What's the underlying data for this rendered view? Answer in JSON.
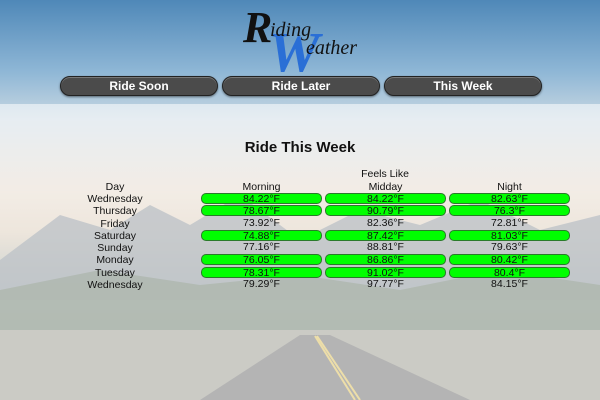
{
  "app": {
    "logo_text": "Riding Weather"
  },
  "nav": [
    {
      "label": "Ride Soon"
    },
    {
      "label": "Ride Later"
    },
    {
      "label": "This Week"
    }
  ],
  "page": {
    "title": "Ride This Week",
    "group_header": "Feels Like"
  },
  "table": {
    "columns": [
      "Day",
      "Morning",
      "Midday",
      "Night"
    ],
    "highlight_color": "#00ff00",
    "rows": [
      {
        "day": "Wednesday",
        "morning": "84.22°F",
        "midday": "84.22°F",
        "night": "82.63°F",
        "morning_good": true,
        "midday_good": true,
        "night_good": true
      },
      {
        "day": "Thursday",
        "morning": "78.67°F",
        "midday": "90.79°F",
        "night": "76.3°F",
        "morning_good": true,
        "midday_good": true,
        "night_good": true
      },
      {
        "day": "Friday",
        "morning": "73.92°F",
        "midday": "82.36°F",
        "night": "72.81°F",
        "morning_good": false,
        "midday_good": false,
        "night_good": false
      },
      {
        "day": "Saturday",
        "morning": "74.88°F",
        "midday": "87.42°F",
        "night": "81.03°F",
        "morning_good": true,
        "midday_good": true,
        "night_good": true
      },
      {
        "day": "Sunday",
        "morning": "77.16°F",
        "midday": "88.81°F",
        "night": "79.63°F",
        "morning_good": false,
        "midday_good": false,
        "night_good": false
      },
      {
        "day": "Monday",
        "morning": "76.05°F",
        "midday": "86.86°F",
        "night": "80.42°F",
        "morning_good": true,
        "midday_good": true,
        "night_good": true
      },
      {
        "day": "Tuesday",
        "morning": "78.31°F",
        "midday": "91.02°F",
        "night": "80.4°F",
        "morning_good": true,
        "midday_good": true,
        "night_good": true
      },
      {
        "day": "Wednesday",
        "morning": "79.29°F",
        "midday": "97.77°F",
        "night": "84.15°F",
        "morning_good": false,
        "midday_good": false,
        "night_good": false
      }
    ]
  }
}
